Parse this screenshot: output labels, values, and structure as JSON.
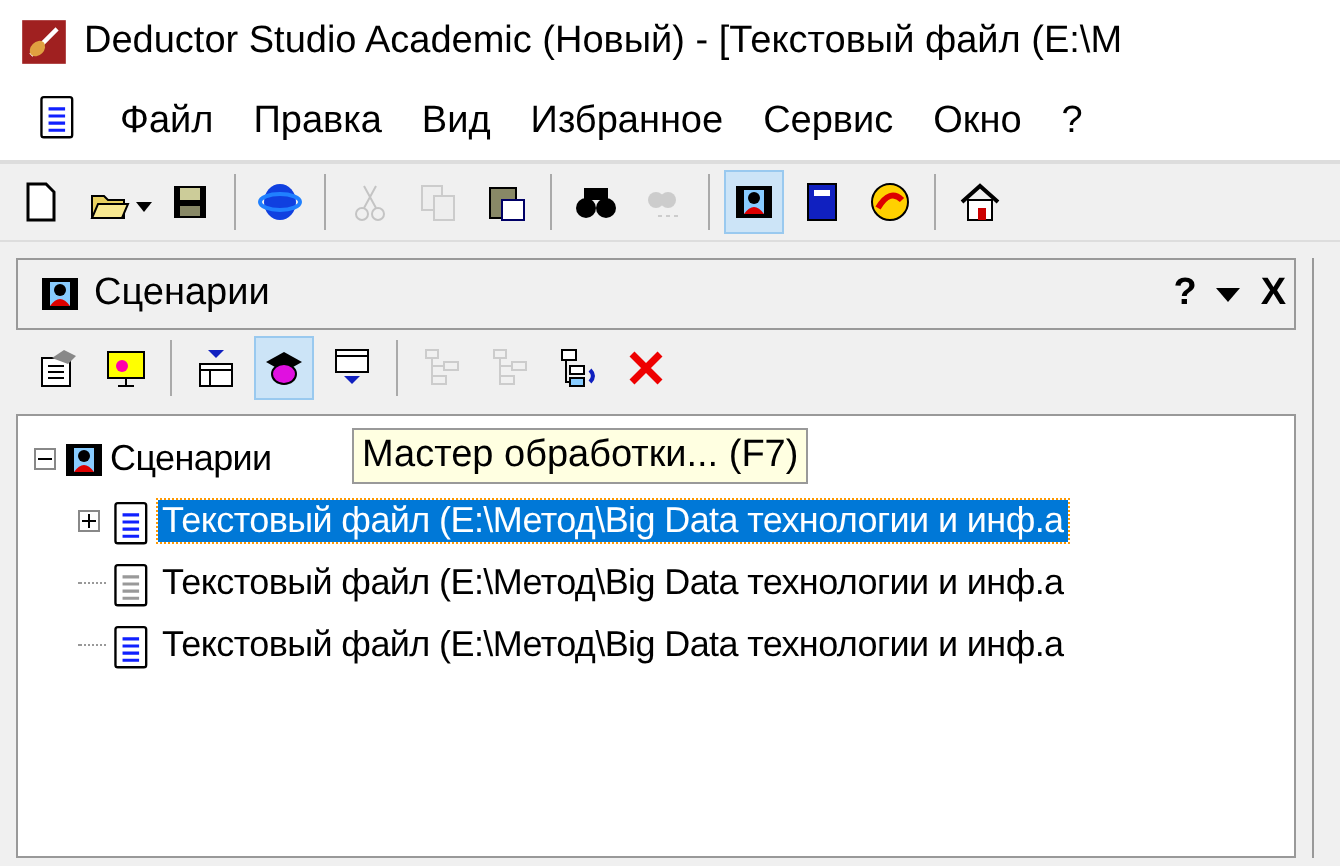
{
  "window": {
    "title": "Deductor Studio Academic (Новый) - [Текстовый файл (E:\\М"
  },
  "menu": [
    "Файл",
    "Правка",
    "Вид",
    "Избранное",
    "Сервис",
    "Окно",
    "?"
  ],
  "toolbar": [
    {
      "kind": "new",
      "disabled": false,
      "pressed": false
    },
    {
      "kind": "open",
      "disabled": false,
      "pressed": false
    },
    {
      "kind": "save",
      "disabled": false,
      "pressed": false
    },
    {
      "kind": "sep"
    },
    {
      "kind": "browser",
      "disabled": false,
      "pressed": false
    },
    {
      "kind": "sep"
    },
    {
      "kind": "cut",
      "disabled": true,
      "pressed": false
    },
    {
      "kind": "copy",
      "disabled": true,
      "pressed": false
    },
    {
      "kind": "paste",
      "disabled": false,
      "pressed": false
    },
    {
      "kind": "sep"
    },
    {
      "kind": "find",
      "disabled": false,
      "pressed": false
    },
    {
      "kind": "findnext",
      "disabled": true,
      "pressed": false
    },
    {
      "kind": "sep"
    },
    {
      "kind": "scenario",
      "disabled": false,
      "pressed": true
    },
    {
      "kind": "book",
      "disabled": false,
      "pressed": false
    },
    {
      "kind": "globe",
      "disabled": false,
      "pressed": false
    },
    {
      "kind": "sep"
    },
    {
      "kind": "home",
      "disabled": false,
      "pressed": false
    }
  ],
  "panel": {
    "title": "Сценарии",
    "help": "?",
    "close": "X",
    "toolbar": [
      {
        "kind": "props",
        "disabled": false,
        "pressed": false
      },
      {
        "kind": "screen",
        "disabled": false,
        "pressed": false
      },
      {
        "kind": "sep"
      },
      {
        "kind": "import",
        "disabled": false,
        "pressed": false
      },
      {
        "kind": "wizard",
        "disabled": false,
        "pressed": true
      },
      {
        "kind": "export",
        "disabled": false,
        "pressed": false
      },
      {
        "kind": "sep"
      },
      {
        "kind": "tree",
        "disabled": true,
        "pressed": false
      },
      {
        "kind": "tree",
        "disabled": true,
        "pressed": false
      },
      {
        "kind": "treego",
        "disabled": false,
        "pressed": false
      },
      {
        "kind": "delete",
        "disabled": false,
        "pressed": false
      }
    ],
    "tree": {
      "label": "Сценарии",
      "expanded": true,
      "children": [
        {
          "label": "Текстовый файл (E:\\Метод\\Big Data технологии и инф.a",
          "selected": true,
          "expandable": true,
          "disabled": false
        },
        {
          "label": "Текстовый файл (E:\\Метод\\Big Data технологии и инф.a",
          "selected": false,
          "expandable": false,
          "disabled": true
        },
        {
          "label": "Текстовый файл (E:\\Метод\\Big Data технологии и инф.a",
          "selected": false,
          "expandable": false,
          "disabled": false
        }
      ]
    },
    "tooltip": "Мастер обработки... (F7)"
  }
}
